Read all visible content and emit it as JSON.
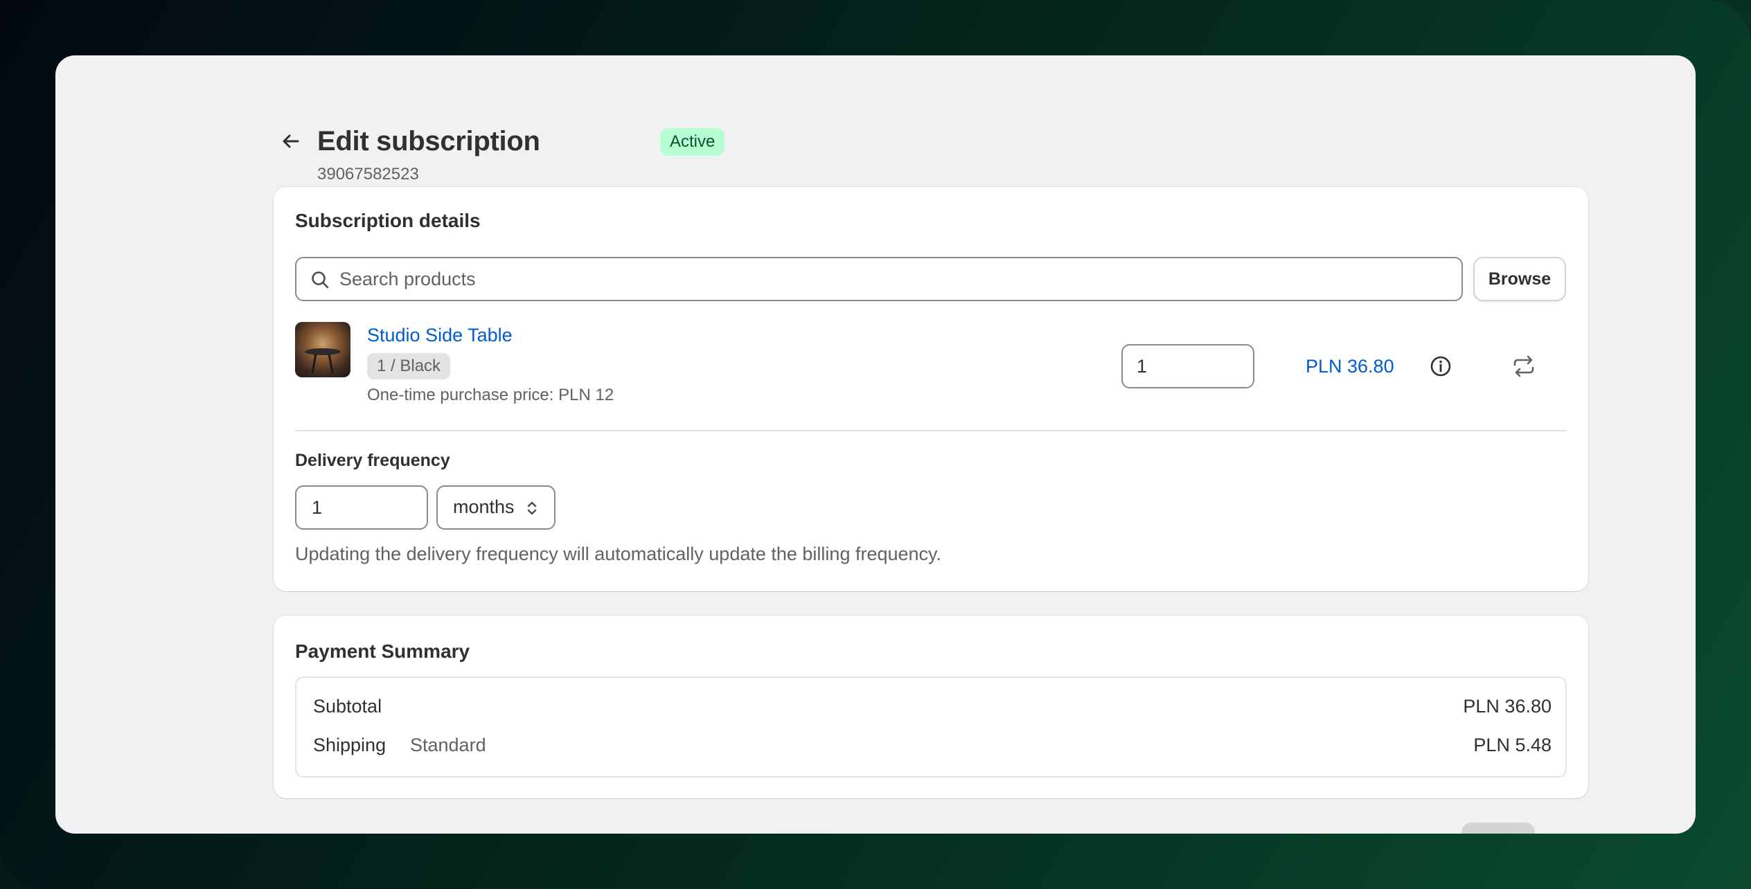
{
  "header": {
    "title": "Edit subscription",
    "status": "Active",
    "subscription_id": "39067582523"
  },
  "details": {
    "title": "Subscription details",
    "search": {
      "placeholder": "Search products",
      "value": ""
    },
    "browse_label": "Browse",
    "product": {
      "name": "Studio Side Table",
      "variant": "1 / Black",
      "one_time_price": "One-time purchase price: PLN 12",
      "quantity": "1",
      "line_price": "PLN 36.80"
    },
    "delivery": {
      "label": "Delivery frequency",
      "interval": "1",
      "unit": "months",
      "help": "Updating the delivery frequency will automatically update the billing frequency."
    }
  },
  "payment": {
    "title": "Payment Summary",
    "subtotal_label": "Subtotal",
    "subtotal_value": "PLN 36.80",
    "shipping_label": "Shipping",
    "shipping_method": "Standard",
    "shipping_value": "PLN 5.48"
  },
  "colors": {
    "badge_bg": "#b4fed2",
    "badge_text": "#0c5132",
    "link": "#005bd3"
  },
  "icons": [
    "arrow-left-icon",
    "search-icon",
    "info-icon",
    "swap-icon",
    "select-chevron-icon"
  ]
}
